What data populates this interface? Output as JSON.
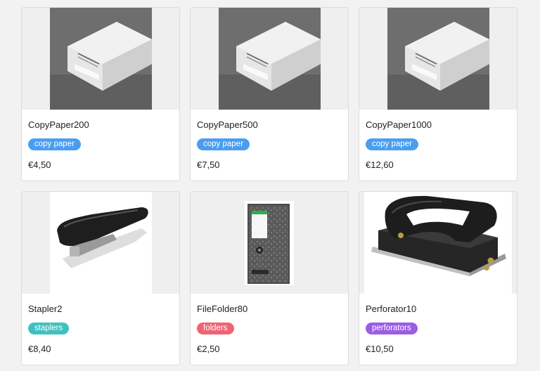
{
  "products": [
    {
      "name": "CopyPaper200",
      "category": "copy paper",
      "category_color": "#4a9ef0",
      "price": "€4,50",
      "image": "copy-paper-image"
    },
    {
      "name": "CopyPaper500",
      "category": "copy paper",
      "category_color": "#4a9ef0",
      "price": "€7,50",
      "image": "copy-paper-image"
    },
    {
      "name": "CopyPaper1000",
      "category": "copy paper",
      "category_color": "#4a9ef0",
      "price": "€12,60",
      "image": "copy-paper-image"
    },
    {
      "name": "Stapler2",
      "category": "staplers",
      "category_color": "#3fc1c0",
      "price": "€8,40",
      "image": "stapler-image"
    },
    {
      "name": "FileFolder80",
      "category": "folders",
      "category_color": "#ef6472",
      "price": "€2,50",
      "image": "file-folder-image"
    },
    {
      "name": "Perforator10",
      "category": "perforators",
      "category_color": "#9b5de5",
      "price": "€10,50",
      "image": "perforator-image"
    }
  ]
}
